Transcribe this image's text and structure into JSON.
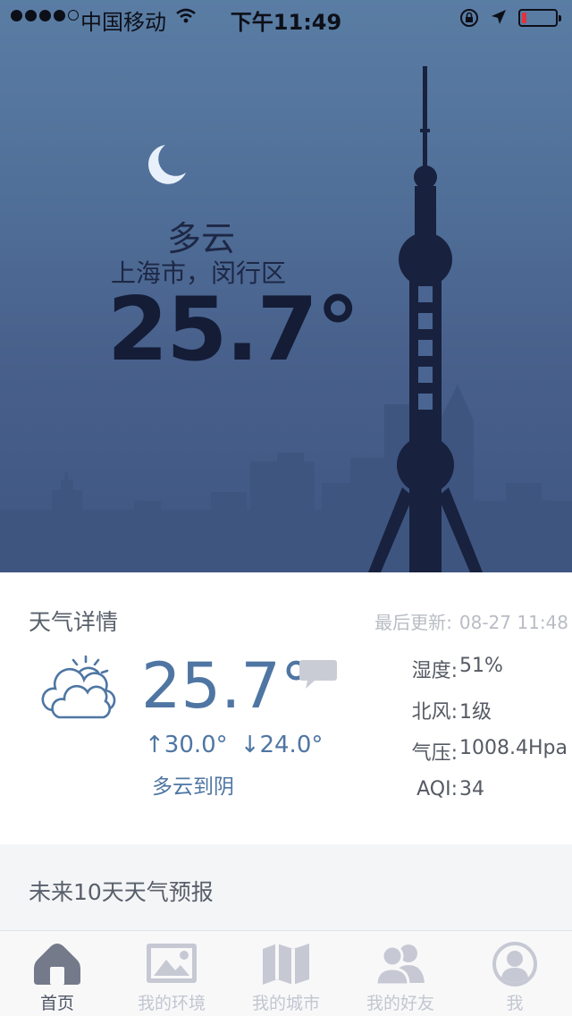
{
  "status_bar": {
    "carrier": "中国移动",
    "time": "下午11:49"
  },
  "weather": {
    "condition": "多云",
    "location": "上海市，闵行区",
    "temperature": "25.7°"
  },
  "details": {
    "title": "天气详情",
    "last_updated_label": "最后更新:",
    "last_updated_value": "08-27 11:48",
    "temperature": "25.7°",
    "high": "↑30.0°",
    "low": "↓24.0°",
    "description": "多云到阴",
    "stats": [
      {
        "label": "湿度:",
        "value": "51%"
      },
      {
        "label": "北风:",
        "value": "1级"
      },
      {
        "label": "气压:",
        "value": "1008.4Hpa"
      },
      {
        "label": "AQI:",
        "value": "34"
      }
    ]
  },
  "forecast": {
    "title": "未来10天天气预报"
  },
  "tabs": [
    {
      "label": "首页",
      "icon": "home-icon",
      "active": true
    },
    {
      "label": "我的环境",
      "icon": "image-icon",
      "active": false
    },
    {
      "label": "我的城市",
      "icon": "map-icon",
      "active": false
    },
    {
      "label": "我的好友",
      "icon": "friends-icon",
      "active": false
    },
    {
      "label": "我",
      "icon": "user-icon",
      "active": false
    }
  ],
  "colors": {
    "accent": "#4f76a3",
    "battery_low": "#e0333a"
  }
}
